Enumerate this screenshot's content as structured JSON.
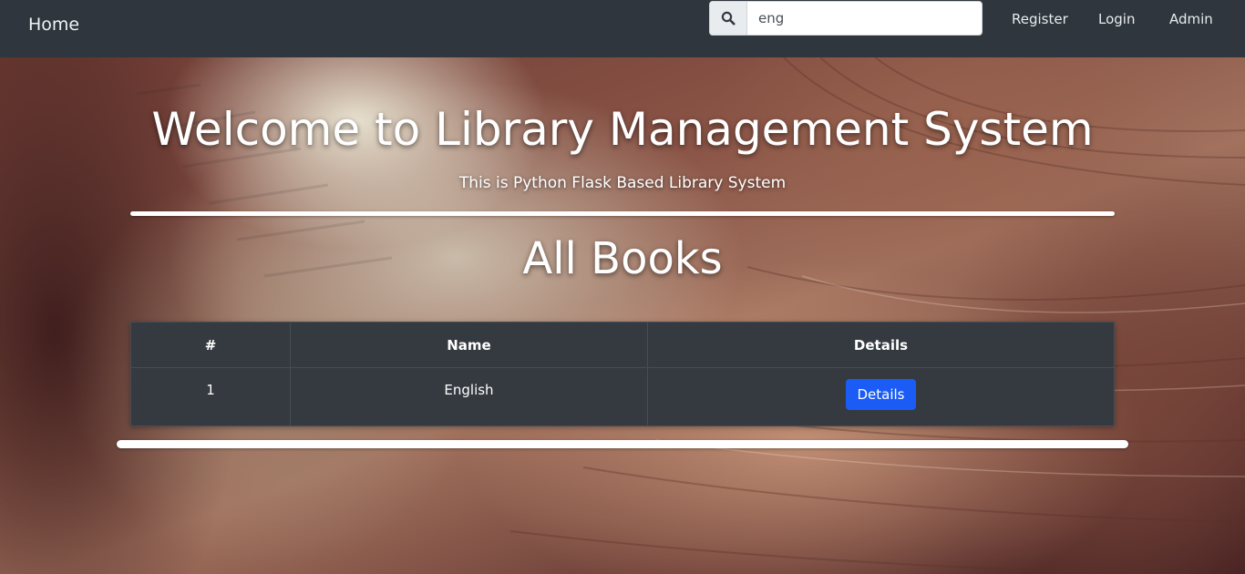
{
  "navbar": {
    "brand": "Home",
    "search": {
      "value": "eng",
      "placeholder": "",
      "icon": "search-icon"
    },
    "links": {
      "register": "Register",
      "login": "Login",
      "admin": "Admin"
    }
  },
  "hero": {
    "title": "Welcome to Library Management System",
    "subtitle": "This is Python Flask Based Library System"
  },
  "books_section": {
    "title": "All Books",
    "table": {
      "headers": {
        "number": "#",
        "name": "Name",
        "details": "Details"
      },
      "rows": [
        {
          "number": "1",
          "name": "English",
          "button": "Details"
        }
      ]
    }
  },
  "colors": {
    "navbar_bg": "#2f363e",
    "table_bg": "#343a40",
    "primary_button": "#1a5cf5"
  }
}
